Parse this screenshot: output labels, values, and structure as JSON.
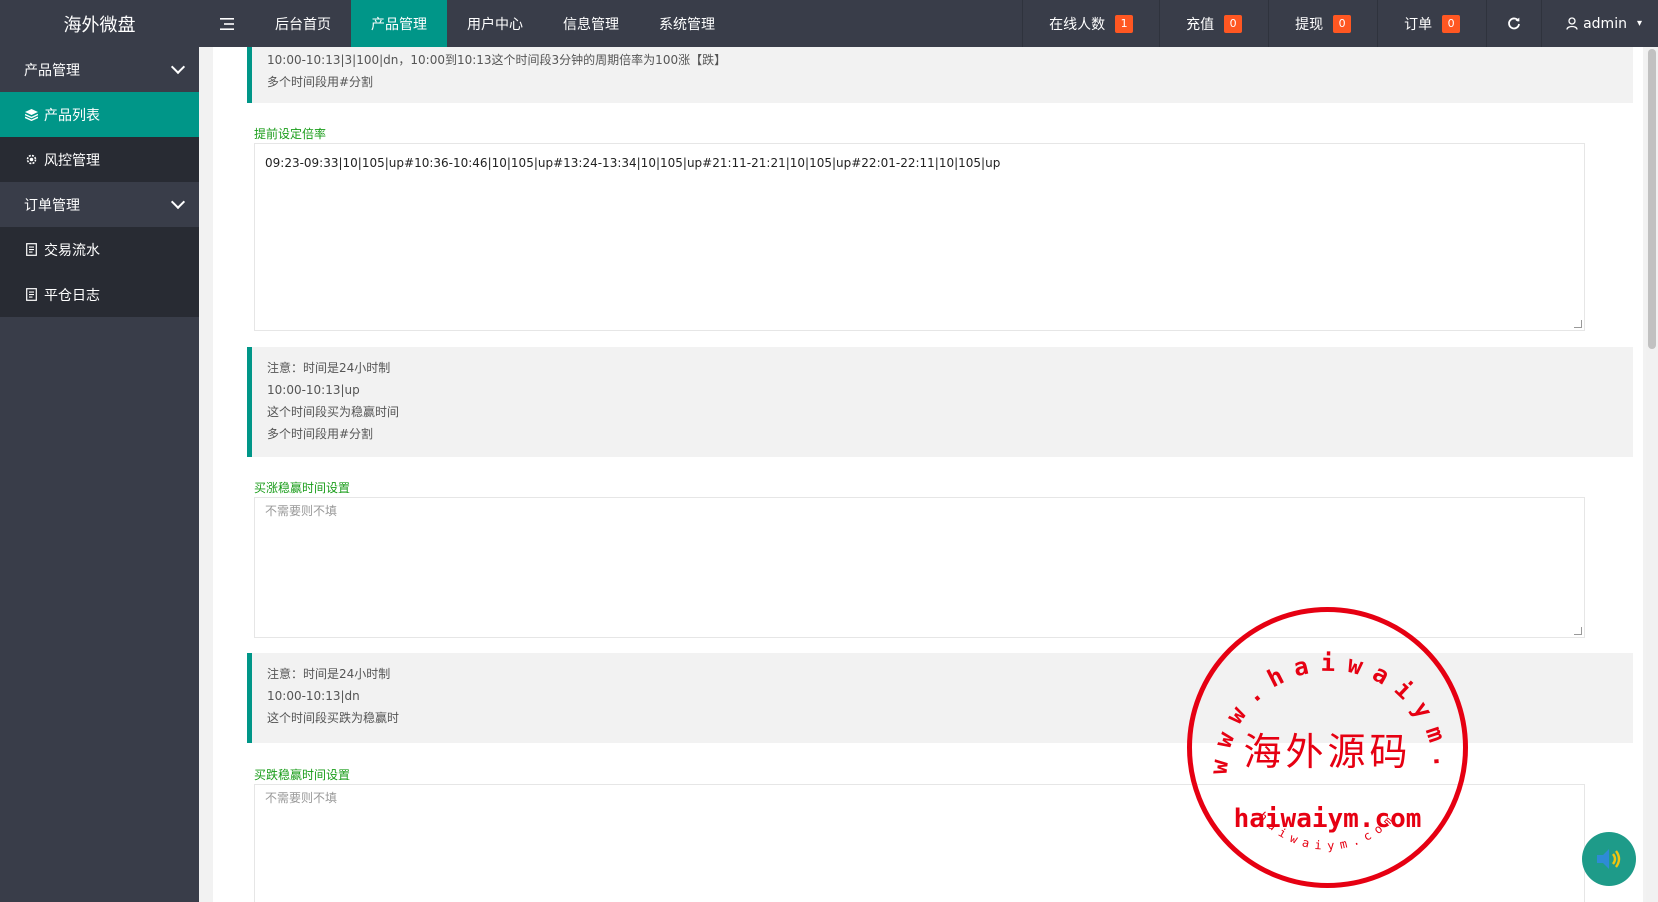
{
  "header": {
    "logo": "海外微盘",
    "nav": [
      "后台首页",
      "产品管理",
      "用户中心",
      "信息管理",
      "系统管理"
    ],
    "active_nav_index": 1,
    "online": {
      "label": "在线人数",
      "count": "1"
    },
    "recharge": {
      "label": "充值",
      "count": "0"
    },
    "withdraw": {
      "label": "提现",
      "count": "0"
    },
    "orders": {
      "label": "订单",
      "count": "0"
    },
    "user": "admin"
  },
  "sidebar": {
    "group1": "产品管理",
    "item1": "产品列表",
    "item2": "风控管理",
    "group2": "订单管理",
    "item3": "交易流水",
    "item4": "平仓日志"
  },
  "content": {
    "tip0": {
      "line1": "10:00-10:13|3|100|dn，10:00到10:13这个时间段3分钟的周期倍率为100涨【跌】",
      "line2": "多个时间段用#分割"
    },
    "rate_label": "提前设定倍率",
    "rate_value": "09:23-09:33|10|105|up#10:36-10:46|10|105|up#13:24-13:34|10|105|up#21:11-21:21|10|105|up#22:01-22:11|10|105|up",
    "tip1": {
      "line1": "注意：时间是24小时制",
      "line2": "10:00-10:13|up",
      "line3": "这个时间段买为稳赢时间",
      "line4": "多个时间段用#分割"
    },
    "up_label": "买涨稳赢时间设置",
    "up_placeholder": "不需要则不填",
    "tip2": {
      "line1": "注意：时间是24小时制",
      "line2": "10:00-10:13|dn",
      "line3": "这个时间段买跌为稳赢时"
    },
    "down_label": "买跌稳赢时间设置",
    "down_placeholder": "不需要则不填"
  },
  "watermark": {
    "arc_text": "www.haiwaiym.com",
    "center_text": "海外源码",
    "bottom_text": "haiwaiym.com",
    "small_text": "haiwaiym.com",
    "color": "#e60012"
  },
  "colors": {
    "accent": "#009688",
    "header_bg": "#393d49",
    "badge": "#ff5722"
  }
}
